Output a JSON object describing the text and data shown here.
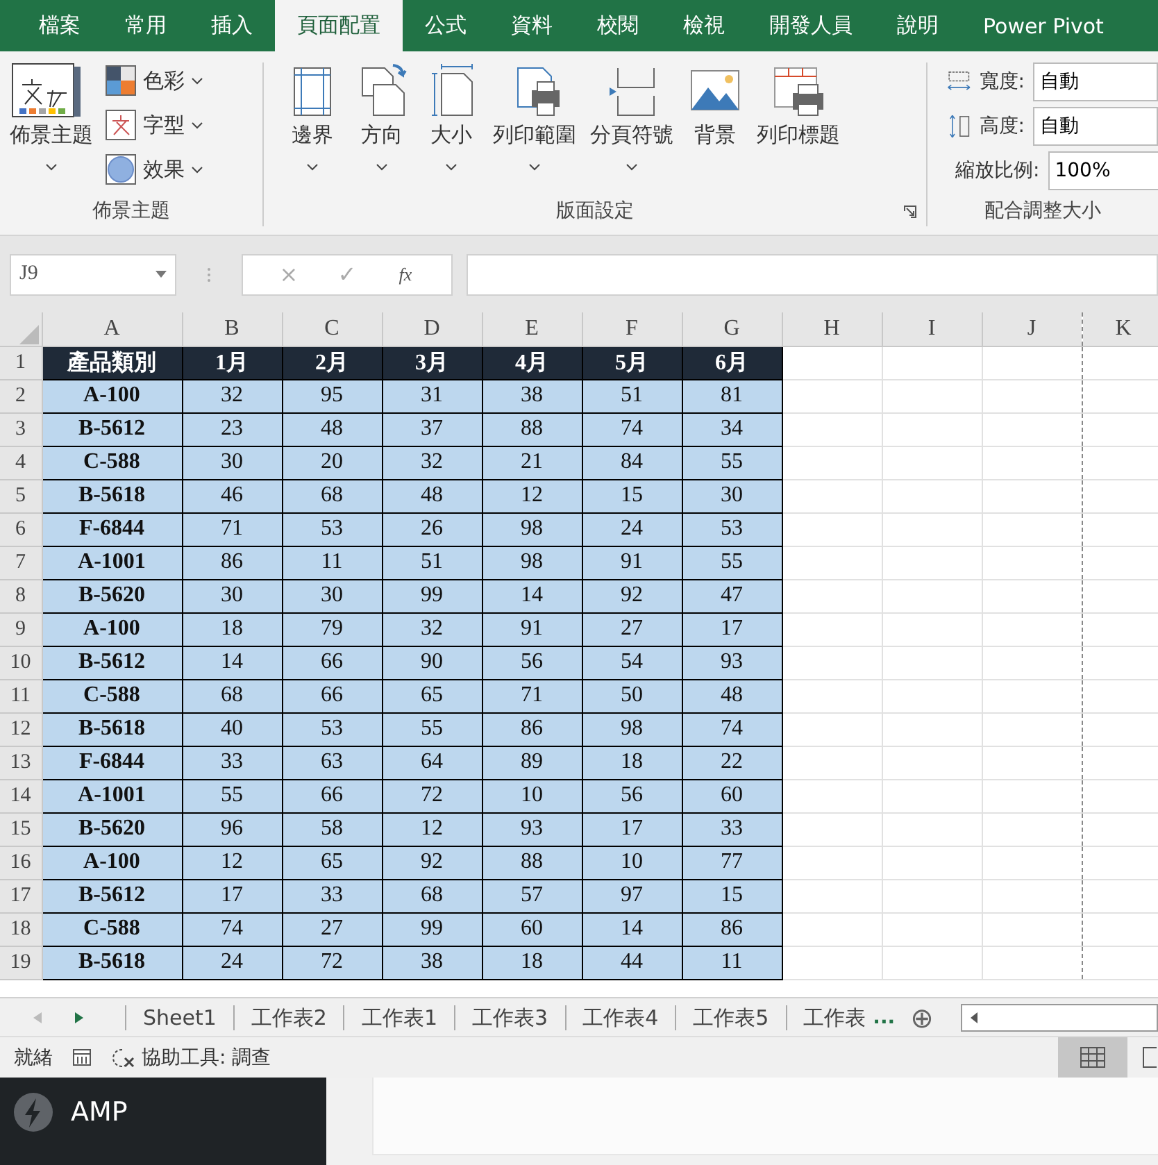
{
  "ribbon_tabs": [
    {
      "label": "檔案",
      "selected": false
    },
    {
      "label": "常用",
      "selected": false
    },
    {
      "label": "插入",
      "selected": false
    },
    {
      "label": "頁面配置",
      "selected": true
    },
    {
      "label": "公式",
      "selected": false
    },
    {
      "label": "資料",
      "selected": false
    },
    {
      "label": "校閱",
      "selected": false
    },
    {
      "label": "檢視",
      "selected": false
    },
    {
      "label": "開發人員",
      "selected": false
    },
    {
      "label": "說明",
      "selected": false
    },
    {
      "label": "Power Pivot",
      "selected": false
    }
  ],
  "themes_group": {
    "title": "佈景主題",
    "main_button": {
      "label": "佈景主題",
      "has_dropdown": true
    },
    "items": [
      {
        "label": "色彩",
        "has_dropdown": true
      },
      {
        "label": "字型",
        "has_dropdown": true
      },
      {
        "label": "效果",
        "has_dropdown": true
      }
    ]
  },
  "page_setup_group": {
    "title": "版面設定",
    "has_launcher": true,
    "buttons": [
      {
        "label": "邊界",
        "has_dropdown": true
      },
      {
        "label": "方向",
        "has_dropdown": true
      },
      {
        "label": "大小",
        "has_dropdown": true
      },
      {
        "label": "列印範圍",
        "has_dropdown": true
      },
      {
        "label": "分頁符號",
        "has_dropdown": true
      },
      {
        "label": "背景",
        "has_dropdown": false
      },
      {
        "label": "列印標題",
        "has_dropdown": false
      }
    ]
  },
  "scale_group": {
    "title": "配合調整大小",
    "rows": [
      {
        "label": "寬度:",
        "value": "自動"
      },
      {
        "label": "高度:",
        "value": "自動"
      },
      {
        "label": "縮放比例:",
        "value": "100%"
      }
    ]
  },
  "name_box": "J9",
  "formula_buttons": [
    "×",
    "✓",
    "fx"
  ],
  "columns": [
    "A",
    "B",
    "C",
    "D",
    "E",
    "F",
    "G",
    "H",
    "I",
    "J",
    "K"
  ],
  "rows": [
    {
      "number": "1",
      "kind": "header",
      "cells": [
        "產品類別",
        "1月",
        "2月",
        "3月",
        "4月",
        "5月",
        "6月"
      ]
    },
    {
      "number": "2",
      "kind": "data",
      "cells": [
        "A-100",
        "32",
        "95",
        "31",
        "38",
        "51",
        "81"
      ]
    },
    {
      "number": "3",
      "kind": "data",
      "cells": [
        "B-5612",
        "23",
        "48",
        "37",
        "88",
        "74",
        "34"
      ]
    },
    {
      "number": "4",
      "kind": "data",
      "cells": [
        "C-588",
        "30",
        "20",
        "32",
        "21",
        "84",
        "55"
      ]
    },
    {
      "number": "5",
      "kind": "data",
      "cells": [
        "B-5618",
        "46",
        "68",
        "48",
        "12",
        "15",
        "30"
      ]
    },
    {
      "number": "6",
      "kind": "data",
      "cells": [
        "F-6844",
        "71",
        "53",
        "26",
        "98",
        "24",
        "53"
      ]
    },
    {
      "number": "7",
      "kind": "data",
      "cells": [
        "A-1001",
        "86",
        "11",
        "51",
        "98",
        "91",
        "55"
      ]
    },
    {
      "number": "8",
      "kind": "data",
      "cells": [
        "B-5620",
        "30",
        "30",
        "99",
        "14",
        "92",
        "47"
      ]
    },
    {
      "number": "9",
      "kind": "data",
      "cells": [
        "A-100",
        "18",
        "79",
        "32",
        "91",
        "27",
        "17"
      ]
    },
    {
      "number": "10",
      "kind": "data",
      "cells": [
        "B-5612",
        "14",
        "66",
        "90",
        "56",
        "54",
        "93"
      ]
    },
    {
      "number": "11",
      "kind": "data",
      "cells": [
        "C-588",
        "68",
        "66",
        "65",
        "71",
        "50",
        "48"
      ]
    },
    {
      "number": "12",
      "kind": "data",
      "cells": [
        "B-5618",
        "40",
        "53",
        "55",
        "86",
        "98",
        "74"
      ]
    },
    {
      "number": "13",
      "kind": "data",
      "cells": [
        "F-6844",
        "33",
        "63",
        "64",
        "89",
        "18",
        "22"
      ]
    },
    {
      "number": "14",
      "kind": "data",
      "cells": [
        "A-1001",
        "55",
        "66",
        "72",
        "10",
        "56",
        "60"
      ]
    },
    {
      "number": "15",
      "kind": "data",
      "cells": [
        "B-5620",
        "96",
        "58",
        "12",
        "93",
        "17",
        "33"
      ]
    },
    {
      "number": "16",
      "kind": "data",
      "cells": [
        "A-100",
        "12",
        "65",
        "92",
        "88",
        "10",
        "77"
      ]
    },
    {
      "number": "17",
      "kind": "data",
      "cells": [
        "B-5612",
        "17",
        "33",
        "68",
        "57",
        "97",
        "15"
      ]
    },
    {
      "number": "18",
      "kind": "data",
      "cells": [
        "C-588",
        "74",
        "27",
        "99",
        "60",
        "14",
        "86"
      ]
    },
    {
      "number": "19",
      "kind": "data",
      "cells": [
        "B-5618",
        "24",
        "72",
        "38",
        "18",
        "44",
        "11"
      ]
    }
  ],
  "sheet_tabs": [
    {
      "label": "Sheet1",
      "selected": false
    },
    {
      "label": "工作表2",
      "selected": false
    },
    {
      "label": "工作表1",
      "selected": false
    },
    {
      "label": "工作表3",
      "selected": false
    },
    {
      "label": "工作表4",
      "selected": false
    },
    {
      "label": "工作表5",
      "selected": false
    },
    {
      "label": "工作表",
      "selected": false
    }
  ],
  "more_sheets": "...",
  "add_sheet": "⊕",
  "status_bar": {
    "ready": "就緒",
    "accessibility": "協助工具: 調查"
  },
  "bottom_panel": {
    "title": "AMP"
  }
}
